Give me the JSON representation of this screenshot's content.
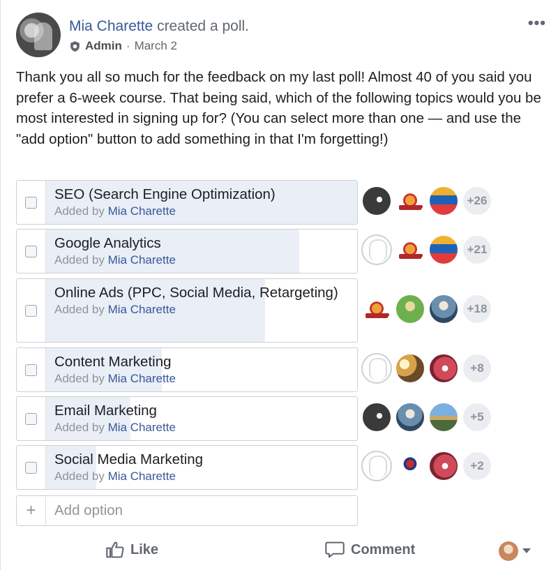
{
  "post": {
    "author": "Mia Charette",
    "action": "created a poll.",
    "role": "Admin",
    "date_separator": "·",
    "date": "March 2",
    "more_label": "•••",
    "text": "Thank you all so much for the feedback on my last poll! Almost 40 of you said you prefer a 6-week course. That being said, which of the following topics would you be most interested in signing up for? (You can select more than one — and use the \"add option\" button to add something in that I'm forgetting!)"
  },
  "poll": {
    "added_by_prefix": "Added by",
    "options": [
      {
        "label": "SEO (Search Engine Optimization)",
        "added_by": "Mia Charette",
        "more_count": "+26",
        "voters": [
          "dark",
          "seal",
          "home"
        ],
        "share": 1.0
      },
      {
        "label": "Google Analytics",
        "added_by": "Mia Charette",
        "more_count": "+21",
        "voters": [
          "blank",
          "seal",
          "home"
        ],
        "share": 0.81
      },
      {
        "label": "Online Ads (PPC, Social Media, Retargeting)",
        "added_by": "Mia Charette",
        "more_count": "+18",
        "voters": [
          "seal",
          "green",
          "person-sky"
        ],
        "share": 0.7
      },
      {
        "label": "Content Marketing",
        "added_by": "Mia Charette",
        "more_count": "+8",
        "voters": [
          "blank",
          "sunset",
          "pink"
        ],
        "share": 0.37
      },
      {
        "label": "Email Marketing",
        "added_by": "Mia Charette",
        "more_count": "+5",
        "voters": [
          "dark",
          "person-sky",
          "field"
        ],
        "share": 0.27
      },
      {
        "label": "Social Media Marketing",
        "added_by": "Mia Charette",
        "more_count": "+2",
        "voters": [
          "blank",
          "crest",
          "pink"
        ],
        "share": 0.16
      }
    ],
    "add_option_placeholder": "Add option"
  },
  "actions": {
    "like_label": "Like",
    "comment_label": "Comment"
  },
  "colors": {
    "link": "#385898",
    "bar_fill": "#e9eef7",
    "muted": "#606770"
  },
  "icons": {
    "admin": "shield-icon",
    "like": "thumbs-up-icon",
    "comment": "comment-bubble-icon",
    "more": "ellipsis-icon",
    "add": "plus-icon",
    "caret": "caret-down-icon"
  }
}
